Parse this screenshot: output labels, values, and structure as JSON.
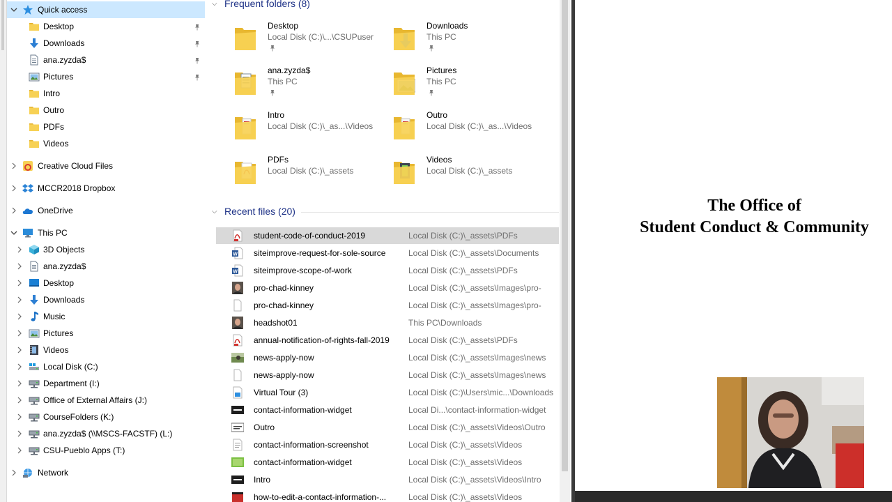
{
  "nav": {
    "items": [
      {
        "label": "Quick access",
        "icon": "star-icon",
        "level": 0,
        "expand": "expanded",
        "selected": true,
        "pinned": false
      },
      {
        "label": "Desktop",
        "icon": "folder-icon",
        "level": 1,
        "expand": "none",
        "pinned": true
      },
      {
        "label": "Downloads",
        "icon": "download-arrow-icon",
        "level": 1,
        "expand": "none",
        "pinned": true
      },
      {
        "label": "ana.zyzda$",
        "icon": "document-icon",
        "level": 1,
        "expand": "none",
        "pinned": true
      },
      {
        "label": "Pictures",
        "icon": "pictures-icon",
        "level": 1,
        "expand": "none",
        "pinned": true
      },
      {
        "label": "Intro",
        "icon": "folder-icon",
        "level": 1,
        "expand": "none",
        "pinned": false
      },
      {
        "label": "Outro",
        "icon": "folder-icon",
        "level": 1,
        "expand": "none",
        "pinned": false
      },
      {
        "label": "PDFs",
        "icon": "folder-icon",
        "level": 1,
        "expand": "none",
        "pinned": false
      },
      {
        "label": "Videos",
        "icon": "folder-icon",
        "level": 1,
        "expand": "none",
        "pinned": false
      },
      {
        "label": "Creative Cloud Files",
        "icon": "creative-cloud-icon",
        "level": 0,
        "expand": "collapsed",
        "pinned": false,
        "gap": true
      },
      {
        "label": "MCCR2018 Dropbox",
        "icon": "dropbox-icon",
        "level": 0,
        "expand": "collapsed",
        "pinned": false,
        "gap": true
      },
      {
        "label": "OneDrive",
        "icon": "onedrive-cloud-icon",
        "level": 0,
        "expand": "collapsed",
        "pinned": false,
        "gap": true
      },
      {
        "label": "This PC",
        "icon": "monitor-icon",
        "level": 0,
        "expand": "expanded",
        "pinned": false,
        "gap": true
      },
      {
        "label": "3D Objects",
        "icon": "cube-icon",
        "level": 1,
        "expand": "collapsed",
        "pinned": false
      },
      {
        "label": "ana.zyzda$",
        "icon": "document-icon",
        "level": 1,
        "expand": "collapsed",
        "pinned": false
      },
      {
        "label": "Desktop",
        "icon": "desktop-icon",
        "level": 1,
        "expand": "collapsed",
        "pinned": false
      },
      {
        "label": "Downloads",
        "icon": "download-arrow-icon",
        "level": 1,
        "expand": "collapsed",
        "pinned": false
      },
      {
        "label": "Music",
        "icon": "music-note-icon",
        "level": 1,
        "expand": "collapsed",
        "pinned": false
      },
      {
        "label": "Pictures",
        "icon": "pictures-icon",
        "level": 1,
        "expand": "collapsed",
        "pinned": false
      },
      {
        "label": "Videos",
        "icon": "film-icon",
        "level": 1,
        "expand": "collapsed",
        "pinned": false
      },
      {
        "label": "Local Disk (C:)",
        "icon": "windows-drive-icon",
        "level": 1,
        "expand": "collapsed",
        "pinned": false
      },
      {
        "label": "Department (I:)",
        "icon": "network-drive-icon",
        "level": 1,
        "expand": "collapsed",
        "pinned": false
      },
      {
        "label": "Office of External Affairs (J:)",
        "icon": "network-drive-icon",
        "level": 1,
        "expand": "collapsed",
        "pinned": false
      },
      {
        "label": "CourseFolders (K:)",
        "icon": "network-drive-icon",
        "level": 1,
        "expand": "collapsed",
        "pinned": false
      },
      {
        "label": "ana.zyzda$ (\\\\MSCS-FACSTF) (L:)",
        "icon": "network-drive-icon",
        "level": 1,
        "expand": "collapsed",
        "pinned": false
      },
      {
        "label": "CSU-Pueblo Apps (T:)",
        "icon": "network-drive-icon",
        "level": 1,
        "expand": "collapsed",
        "pinned": false
      },
      {
        "label": "Network",
        "icon": "network-icon",
        "level": 0,
        "expand": "collapsed",
        "pinned": false,
        "gap": true
      }
    ]
  },
  "frequent": {
    "header": "Frequent folders (8)",
    "folders": [
      {
        "name": "Desktop",
        "path": "Local Disk (C:)\\...\\CSUPuser",
        "pinned": true,
        "overlay": "none"
      },
      {
        "name": "Downloads",
        "path": "This PC",
        "pinned": true,
        "overlay": "download"
      },
      {
        "name": "ana.zyzda$",
        "path": "This PC",
        "pinned": true,
        "overlay": "document"
      },
      {
        "name": "Pictures",
        "path": "This PC",
        "pinned": true,
        "overlay": "picture"
      },
      {
        "name": "Intro",
        "path": "Local Disk (C:)\\_as...\\Videos",
        "pinned": false,
        "overlay": "paper"
      },
      {
        "name": "Outro",
        "path": "Local Disk (C:)\\_as...\\Videos",
        "pinned": false,
        "overlay": "paper"
      },
      {
        "name": "PDFs",
        "path": "Local Disk (C:)\\_assets",
        "pinned": false,
        "overlay": "pdf"
      },
      {
        "name": "Videos",
        "path": "Local Disk (C:)\\_assets",
        "pinned": false,
        "overlay": "film"
      }
    ]
  },
  "recent": {
    "header": "Recent files (20)",
    "files": [
      {
        "name": "student-code-of-conduct-2019",
        "location": "Local Disk (C:)\\_assets\\PDFs",
        "icon": "pdf-file-icon",
        "selected": true
      },
      {
        "name": "siteimprove-request-for-sole-source",
        "location": "Local Disk (C:)\\_assets\\Documents",
        "icon": "word-file-icon"
      },
      {
        "name": "siteimprove-scope-of-work",
        "location": "Local Disk (C:)\\_assets\\PDFs",
        "icon": "word-file-icon"
      },
      {
        "name": "pro-chad-kinney",
        "location": "Local Disk (C:)\\_assets\\Images\\pro-",
        "icon": "photo-portrait-icon"
      },
      {
        "name": "pro-chad-kinney",
        "location": "Local Disk (C:)\\_assets\\Images\\pro-",
        "icon": "blank-file-icon"
      },
      {
        "name": "headshot01",
        "location": "This PC\\Downloads",
        "icon": "photo-portrait-icon"
      },
      {
        "name": "annual-notification-of-rights-fall-2019",
        "location": "Local Disk (C:)\\_assets\\PDFs",
        "icon": "pdf-file-icon"
      },
      {
        "name": "news-apply-now",
        "location": "Local Disk (C:)\\_assets\\Images\\news",
        "icon": "photo-landscape-icon"
      },
      {
        "name": "news-apply-now",
        "location": "Local Disk (C:)\\_assets\\Images\\news",
        "icon": "blank-file-icon"
      },
      {
        "name": "Virtual Tour (3)",
        "location": "Local Disk (C:)\\Users\\mic...\\Downloads",
        "icon": "installer-file-icon"
      },
      {
        "name": "contact-information-widget",
        "location": "Local Di...\\contact-information-widget",
        "icon": "video-thumb-icon"
      },
      {
        "name": "Outro",
        "location": "Local Disk (C:)\\_assets\\Videos\\Outro",
        "icon": "video-frame-icon"
      },
      {
        "name": "contact-information-screenshot",
        "location": "Local Disk (C:)\\_assets\\Videos",
        "icon": "text-file-icon"
      },
      {
        "name": "contact-information-widget",
        "location": "Local Disk (C:)\\_assets\\Videos",
        "icon": "green-image-icon"
      },
      {
        "name": "Intro",
        "location": "Local Disk (C:)\\_assets\\Videos\\Intro",
        "icon": "video-thumb-icon"
      },
      {
        "name": "how-to-edit-a-contact-information-...",
        "location": "Local Disk (C:)\\_assets\\Videos",
        "icon": "red-video-icon"
      }
    ]
  },
  "slide": {
    "title_line1": "The Office of",
    "title_line2": "Student Conduct & Community"
  },
  "colors": {
    "nav_selected": "#cce8ff",
    "row_selected": "#d9d9d9",
    "header_text": "#1e3287",
    "folder_yellow": "#f7d155",
    "subtext_gray": "#6d6d6d"
  }
}
